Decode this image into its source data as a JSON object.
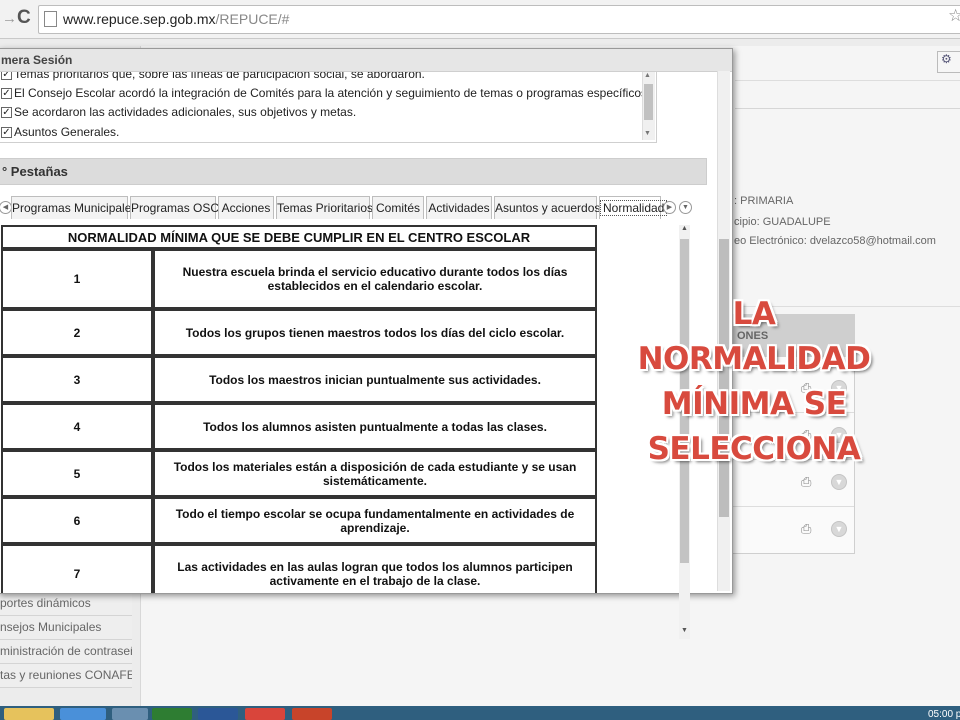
{
  "browser": {
    "url_host": "www.repuce.sep.gob.mx",
    "url_path": "/REPUCE/#"
  },
  "background": {
    "nivel": ": PRIMARIA",
    "municipio": "cipio: GUADALUPE",
    "correo": "eo Electrónico: dvelazco58@hotmail.com",
    "actions_header": "ONES",
    "sidebar": [
      "portes dinámicos",
      "nsejos Municipales",
      "ministración de contraseñas",
      "tas y reuniones CONAFE"
    ]
  },
  "modal": {
    "title": "mera Sesión",
    "checklist": [
      "Temas prioritarios que, sobre las líneas de participación social, se abordarón.",
      "El Consejo Escolar acordó la integración de Comités para la atención y seguimiento de temas o programas específicos.",
      "Se acordaron las actividades adicionales, sus objetivos y metas.",
      "Asuntos Generales."
    ],
    "section_title": "° Pestañas",
    "tabs": [
      "Programas Municipales",
      "Programas OSC",
      "Acciones",
      "Temas Prioritarios",
      "Comités",
      "Actividades",
      "Asuntos y acuerdos",
      "Normalidad"
    ],
    "active_tab": "Normalidad",
    "table": {
      "header": "NORMALIDAD MÍNIMA QUE SE DEBE CUMPLIR EN EL CENTRO ESCOLAR",
      "rows": [
        {
          "num": "1",
          "text": "Nuestra escuela brinda el servicio educativo durante todos los días establecidos en el calendario escolar."
        },
        {
          "num": "2",
          "text": "Todos los grupos tienen maestros todos los días del ciclo escolar."
        },
        {
          "num": "3",
          "text": "Todos los maestros inician puntualmente sus actividades."
        },
        {
          "num": "4",
          "text": "Todos los alumnos asisten puntualmente a todas las clases."
        },
        {
          "num": "5",
          "text": "Todos los materiales están a disposición de cada estudiante y se usan sistemáticamente."
        },
        {
          "num": "6",
          "text": "Todo el tiempo escolar se ocupa fundamentalmente en actividades de aprendizaje."
        },
        {
          "num": "7",
          "text": "Las actividades en las aulas logran que todos los alumnos participen activamente en el trabajo de la clase."
        }
      ]
    }
  },
  "annotation": [
    "LA",
    "NORMALIDAD",
    "MÍNIMA SE",
    "SELECCIONA"
  ],
  "taskbar": {
    "time": "05:00 p"
  },
  "colors": {
    "annotation": "#d84a3e",
    "taskbar": "#2f5f7f"
  }
}
